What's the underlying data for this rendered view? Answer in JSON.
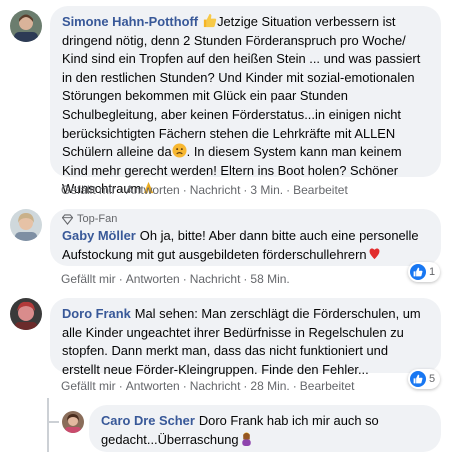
{
  "comments": [
    {
      "author": "Simone Hahn-Potthoff",
      "text_a": "Jetzige Situation verbessern ist dringend nötig, denn 2 Stunden Förderanspruch pro Woche/ Kind sind ein Tropfen auf den heißen Stein ... und was passiert in den restlichen Stunden? Und Kinder mit sozial-emotionalen Störungen bekommen mit Glück ein paar Stunden Schulbegleitung, aber keinen Förderstatus...in einigen nicht berücksichtigten Fächern stehen die Lehrkräfte mit ALLEN Schülern alleine da",
      "text_b": ". In diesem System kann man keinem Kind mehr gerecht werden! Eltern ins Boot holen? Schöner Wunschtraum",
      "actions": {
        "like": "Gefällt mir",
        "reply": "Antworten",
        "message": "Nachricht",
        "time": "3 Min.",
        "edited": "Bearbeitet"
      }
    },
    {
      "badge": "Top-Fan",
      "author": "Gaby Möller",
      "text": "Oh ja, bitte! Aber dann bitte auch eine personelle Aufstockung mit gut ausgebildeten förderschullehrern",
      "reaction_count": "1",
      "actions": {
        "like": "Gefällt mir",
        "reply": "Antworten",
        "message": "Nachricht",
        "time": "58 Min."
      }
    },
    {
      "author": "Doro Frank",
      "text": "Mal sehen: Man zerschlägt die Förderschulen, um alle Kinder ungeachtet ihrer Bedürfnisse in Regelschulen zu stopfen. Dann merkt man, dass das nicht funktioniert und erstellt neue Förder-Kleingruppen. Finde den Fehler...",
      "reaction_count": "5",
      "actions": {
        "like": "Gefällt mir",
        "reply": "Antworten",
        "message": "Nachricht",
        "time": "28 Min.",
        "edited": "Bearbeitet"
      }
    },
    {
      "author": "Caro Dre Scher",
      "text": "Doro Frank hab ich mir auch so gedacht...Überraschung"
    }
  ],
  "colors": {
    "bubble": "#f0f2f5",
    "author": "#385898",
    "meta": "#65676b",
    "like": "#1877f2"
  }
}
